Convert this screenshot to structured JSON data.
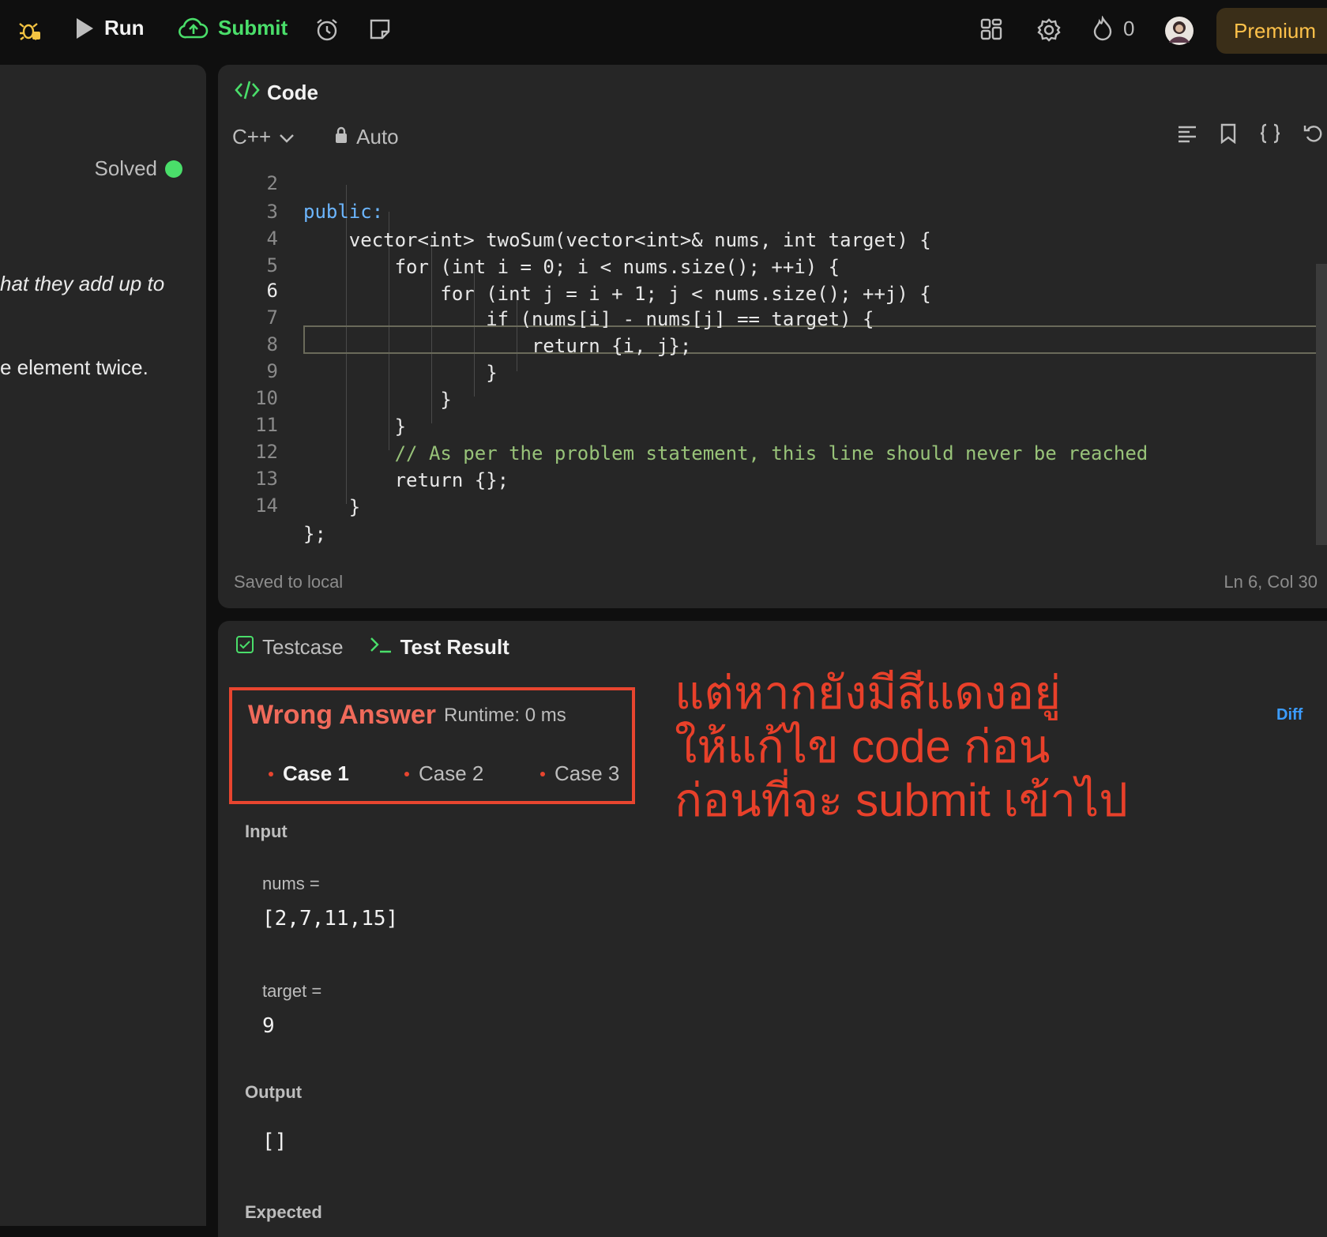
{
  "topbar": {
    "run_label": "Run",
    "submit_label": "Submit",
    "streak_count": "0",
    "premium_label": "Premium"
  },
  "description": {
    "solved_label": "Solved",
    "line1": "hat they add up to",
    "line2": "e element twice."
  },
  "editor": {
    "panel_title": "Code",
    "language": "C++",
    "mode": "Auto",
    "footer_status": "Saved to local",
    "cursor_position": "Ln 6, Col 30",
    "lines": [
      {
        "n": "2",
        "text": "public:"
      },
      {
        "n": "3",
        "text": "    vector<int> twoSum(vector<int>& nums, int target) {"
      },
      {
        "n": "4",
        "text": "        for (int i = 0; i < nums.size(); ++i) {"
      },
      {
        "n": "5",
        "text": "            for (int j = i + 1; j < nums.size(); ++j) {"
      },
      {
        "n": "6",
        "text": "                if (nums[i] - nums[j] == target) {"
      },
      {
        "n": "7",
        "text": "                    return {i, j};"
      },
      {
        "n": "8",
        "text": "                }"
      },
      {
        "n": "9",
        "text": "            }"
      },
      {
        "n": "10",
        "text": "        }"
      },
      {
        "n": "11",
        "text": "        // As per the problem statement, this line should never be reached"
      },
      {
        "n": "12",
        "text": "        return {};"
      },
      {
        "n": "13",
        "text": "    }"
      },
      {
        "n": "14",
        "text": "};"
      }
    ]
  },
  "result": {
    "tab_testcase": "Testcase",
    "tab_result": "Test Result",
    "verdict": "Wrong Answer",
    "runtime": "Runtime: 0 ms",
    "cases": [
      "Case 1",
      "Case 2",
      "Case 3"
    ],
    "diff_label": "Diff",
    "input_label": "Input",
    "nums_label": "nums =",
    "nums_value": "[2,7,11,15]",
    "target_label": "target =",
    "target_value": "9",
    "output_label": "Output",
    "output_value": "[]",
    "expected_label": "Expected"
  },
  "annotation": {
    "line1": "แต่หากยังมีสีแดงอยู่",
    "line2": "ให้แก้ไข code ก่อน",
    "line3": "ก่อนที่จะ submit เข้าไป"
  },
  "colors": {
    "accent_green": "#4ade6a",
    "error_red": "#e8452f",
    "premium_gold": "#ffc24a"
  }
}
